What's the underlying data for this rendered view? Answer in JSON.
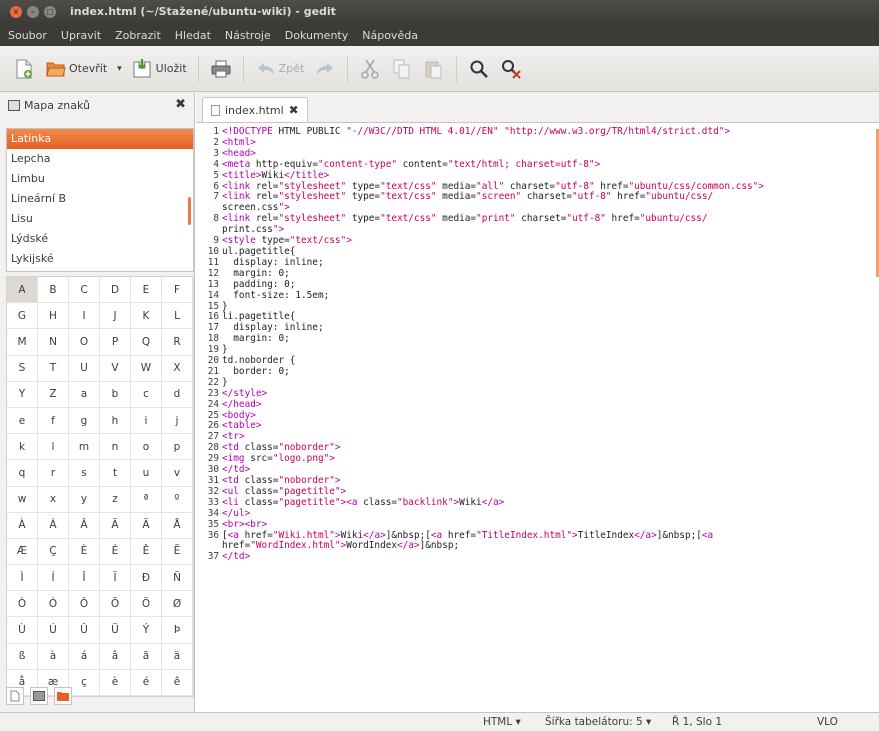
{
  "window": {
    "title": "index.html (~/Stažené/ubuntu-wiki) - gedit"
  },
  "menubar": [
    "Soubor",
    "Upravit",
    "Zobrazit",
    "Hledat",
    "Nástroje",
    "Dokumenty",
    "Nápověda"
  ],
  "toolbar": {
    "open_label": "Otevřít",
    "save_label": "Uložit",
    "undo_label": "Zpět"
  },
  "sidepanel": {
    "title": "Mapa znaků",
    "scripts": [
      "Latinka",
      "Lepcha",
      "Limbu",
      "Lineární B",
      "Lisu",
      "Lýdské",
      "Lykijské"
    ],
    "selected_script": "Latinka",
    "chars": [
      "A",
      "B",
      "C",
      "D",
      "E",
      "F",
      "G",
      "H",
      "I",
      "J",
      "K",
      "L",
      "M",
      "N",
      "O",
      "P",
      "Q",
      "R",
      "S",
      "T",
      "U",
      "V",
      "W",
      "X",
      "Y",
      "Z",
      "a",
      "b",
      "c",
      "d",
      "e",
      "f",
      "g",
      "h",
      "i",
      "j",
      "k",
      "l",
      "m",
      "n",
      "o",
      "p",
      "q",
      "r",
      "s",
      "t",
      "u",
      "v",
      "w",
      "x",
      "y",
      "z",
      "ª",
      "º",
      "À",
      "Á",
      "Â",
      "Ã",
      "Ä",
      "Å",
      "Æ",
      "Ç",
      "È",
      "É",
      "Ê",
      "Ë",
      "Ì",
      "Í",
      "Î",
      "Ï",
      "Ð",
      "Ñ",
      "Ò",
      "Ó",
      "Ô",
      "Õ",
      "Ö",
      "Ø",
      "Ù",
      "Ú",
      "Û",
      "Ü",
      "Ý",
      "Þ",
      "ß",
      "à",
      "á",
      "â",
      "ã",
      "ä",
      "å",
      "æ",
      "ç",
      "è",
      "é",
      "ê"
    ]
  },
  "tab": {
    "label": "index.html"
  },
  "editor": {
    "lines": [
      {
        "n": "1",
        "t": "<!DOCTYPE HTML PUBLIC \"-//W3C//DTD HTML 4.01//EN\" \"http://www.w3.org/TR/html4/strict.dtd\">"
      },
      {
        "n": "2",
        "t": "<html>"
      },
      {
        "n": "3",
        "t": "<head>"
      },
      {
        "n": "4",
        "t": "<meta http-equiv=\"content-type\" content=\"text/html; charset=utf-8\">"
      },
      {
        "n": "5",
        "t": "<title>Wiki</title>"
      },
      {
        "n": "6",
        "t": "<link rel=\"stylesheet\" type=\"text/css\" media=\"all\" charset=\"utf-8\" href=\"ubuntu/css/common.css\">"
      },
      {
        "n": "7",
        "t": "<link rel=\"stylesheet\" type=\"text/css\" media=\"screen\" charset=\"utf-8\" href=\"ubuntu/css/"
      },
      {
        "n": "",
        "t": "screen.css\">"
      },
      {
        "n": "8",
        "t": "<link rel=\"stylesheet\" type=\"text/css\" media=\"print\" charset=\"utf-8\" href=\"ubuntu/css/"
      },
      {
        "n": "",
        "t": "print.css\">"
      },
      {
        "n": "9",
        "t": "<style type=\"text/css\">"
      },
      {
        "n": "10",
        "t": "ul.pagetitle{"
      },
      {
        "n": "11",
        "t": "  display: inline;"
      },
      {
        "n": "12",
        "t": "  margin: 0;"
      },
      {
        "n": "13",
        "t": "  padding: 0;"
      },
      {
        "n": "14",
        "t": "  font-size: 1.5em;"
      },
      {
        "n": "15",
        "t": "}"
      },
      {
        "n": "16",
        "t": "li.pagetitle{"
      },
      {
        "n": "17",
        "t": "  display: inline;"
      },
      {
        "n": "18",
        "t": "  margin: 0;"
      },
      {
        "n": "19",
        "t": "}"
      },
      {
        "n": "20",
        "t": "td.noborder {"
      },
      {
        "n": "21",
        "t": "  border: 0;"
      },
      {
        "n": "22",
        "t": "}"
      },
      {
        "n": "23",
        "t": "</style>"
      },
      {
        "n": "24",
        "t": "</head>"
      },
      {
        "n": "25",
        "t": "<body>"
      },
      {
        "n": "26",
        "t": "<table>"
      },
      {
        "n": "27",
        "t": "<tr>"
      },
      {
        "n": "28",
        "t": "<td class=\"noborder\">"
      },
      {
        "n": "29",
        "t": "<img src=\"logo.png\">"
      },
      {
        "n": "30",
        "t": "</td>"
      },
      {
        "n": "31",
        "t": "<td class=\"noborder\">"
      },
      {
        "n": "32",
        "t": "<ul class=\"pagetitle\">"
      },
      {
        "n": "33",
        "t": "<li class=\"pagetitle\"><a class=\"backlink\">Wiki</a>"
      },
      {
        "n": "34",
        "t": "</ul>"
      },
      {
        "n": "35",
        "t": "<br><br>"
      },
      {
        "n": "36",
        "t": "[<a href=\"Wiki.html\">Wiki</a>]&nbsp;[<a href=\"TitleIndex.html\">TitleIndex</a>]&nbsp;[<a"
      },
      {
        "n": "",
        "t": "href=\"WordIndex.html\">WordIndex</a>]&nbsp;"
      },
      {
        "n": "37",
        "t": "</td>"
      }
    ]
  },
  "statusbar": {
    "language": "HTML",
    "tab_width": "Šířka tabelátoru: 5",
    "position": "Ř 1, Slo 1",
    "mode": "VLO"
  },
  "colors": {
    "accent": "#e65f23",
    "titlebar": "#3c3b37",
    "tag": "#b100b1",
    "string": "#c8005a"
  }
}
